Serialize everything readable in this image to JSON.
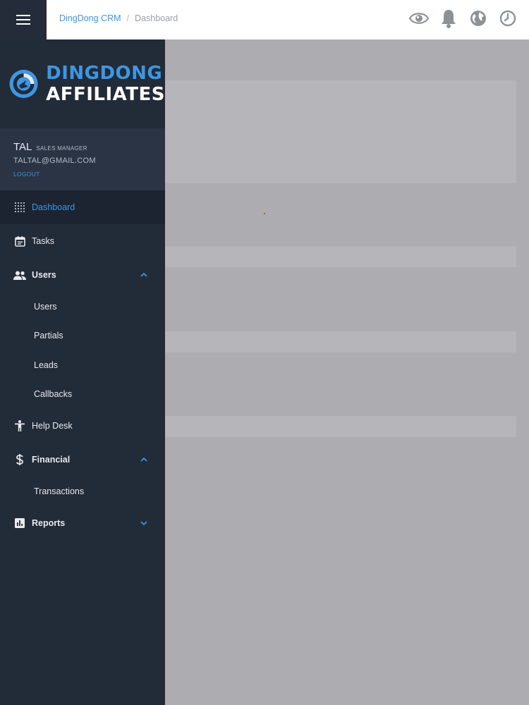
{
  "breadcrumb": {
    "app": "DingDong CRM",
    "separator": "/",
    "current": "Dashboard"
  },
  "header_icons": [
    "eye-icon",
    "bell-icon",
    "globe-icon",
    "clock-icon"
  ],
  "logo": {
    "line1": "DINGDONG",
    "line2": "AFFILIATES"
  },
  "profile": {
    "name": "TAL",
    "role": "SALES MANAGER",
    "email": "TALTAL@GMAIL.COM",
    "logout": "LOGOUT"
  },
  "nav": {
    "dashboard": "Dashboard",
    "tasks": "Tasks",
    "users": "Users",
    "users_sub": [
      "Users",
      "Partials",
      "Leads",
      "Callbacks"
    ],
    "helpdesk": "Help Desk",
    "financial": "Financial",
    "financial_sub": [
      "Transactions"
    ],
    "reports": "Reports"
  },
  "colors": {
    "sidebar": "#222b38",
    "accent": "#3d97e3",
    "overlay": "#adacb0",
    "topbar": "#ffffff"
  }
}
